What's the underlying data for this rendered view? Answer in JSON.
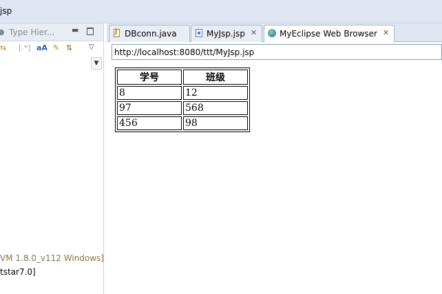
{
  "window": {
    "title": "jsp"
  },
  "left_view": {
    "tab_label": "Type Hier...",
    "console_lines": [
      "VM 1.8.0_v112 Windows]",
      "tstar7.0]"
    ]
  },
  "editor": {
    "tabs": [
      {
        "label": "DBconn.java",
        "icon": "java-file-icon",
        "active": false,
        "closable": false
      },
      {
        "label": "MyJsp.jsp",
        "icon": "jsp-file-icon",
        "active": false,
        "closable": true
      },
      {
        "label": "MyEclipse Web Browser",
        "icon": "globe-icon",
        "active": true,
        "closable": true
      }
    ],
    "close_glyph": "✕"
  },
  "browser": {
    "url": "http://localhost:8080/ttt/MyJsp.jsp",
    "table": {
      "headers": [
        "学号",
        "班级"
      ],
      "rows": [
        [
          "8",
          "12"
        ],
        [
          "97",
          "568"
        ],
        [
          "456",
          "98"
        ]
      ]
    }
  },
  "colors": {
    "chrome_bg": "#dfe6f2",
    "active_tab_bg": "#ffffff",
    "console_vm_text": "#8b7245",
    "url_border": "#7f9db9"
  }
}
